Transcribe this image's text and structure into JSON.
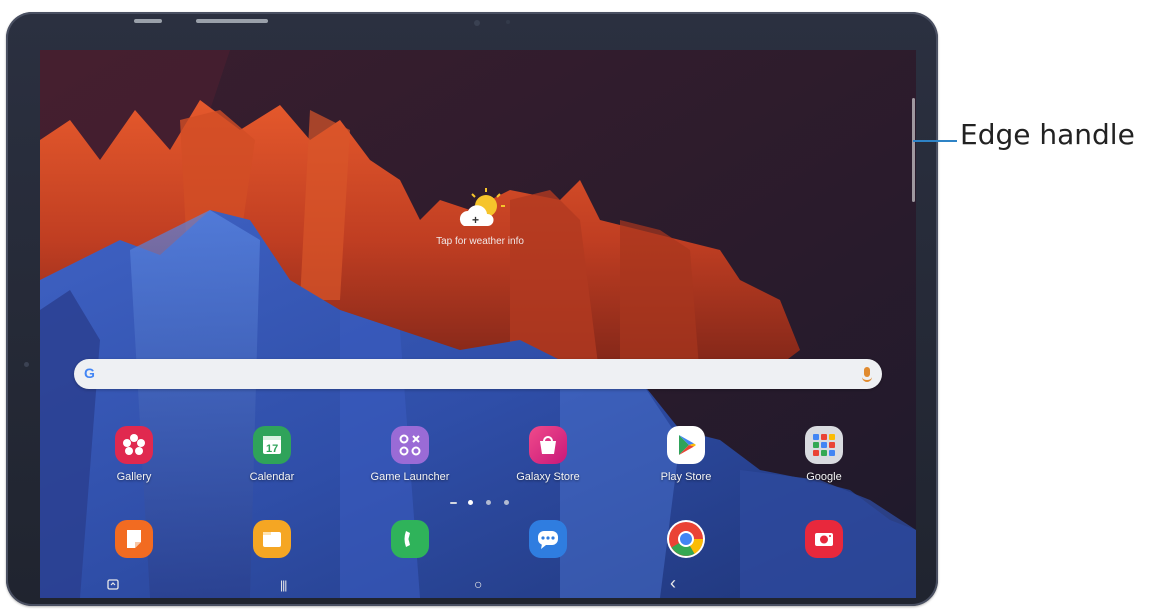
{
  "weather": {
    "label": "Tap for weather info"
  },
  "search": {
    "logo": "G",
    "icon": "mic-icon"
  },
  "apps_row1": [
    {
      "label": "Gallery",
      "icon": "gallery-icon",
      "color": "#e0294f"
    },
    {
      "label": "Calendar",
      "icon": "calendar-icon",
      "color": "#2fa35a"
    },
    {
      "label": "Game Launcher",
      "icon": "game-launcher-icon",
      "color": "#9a6bd6"
    },
    {
      "label": "Galaxy Store",
      "icon": "galaxy-store-icon",
      "color": "#e4267a"
    },
    {
      "label": "Play Store",
      "icon": "play-store-icon",
      "color": "#ffffff"
    },
    {
      "label": "Google",
      "icon": "google-folder-icon",
      "color": "#d9dbe0"
    }
  ],
  "dock": [
    {
      "icon": "samsung-notes-icon",
      "color": "#f26b21"
    },
    {
      "icon": "my-files-icon",
      "color": "#f5a623"
    },
    {
      "icon": "phone-icon",
      "color": "#2fb35a"
    },
    {
      "icon": "messages-icon",
      "color": "#2f7de0"
    },
    {
      "icon": "chrome-icon",
      "color": "#ffffff"
    },
    {
      "icon": "camera-icon",
      "color": "#e8283c"
    }
  ],
  "pager": {
    "pages": 3,
    "current": 1
  },
  "nav": {
    "apps_edge_icon": "screenshot-icon",
    "recents": "|||",
    "home": "○",
    "back": "‹"
  },
  "callout": {
    "label": "Edge handle"
  }
}
